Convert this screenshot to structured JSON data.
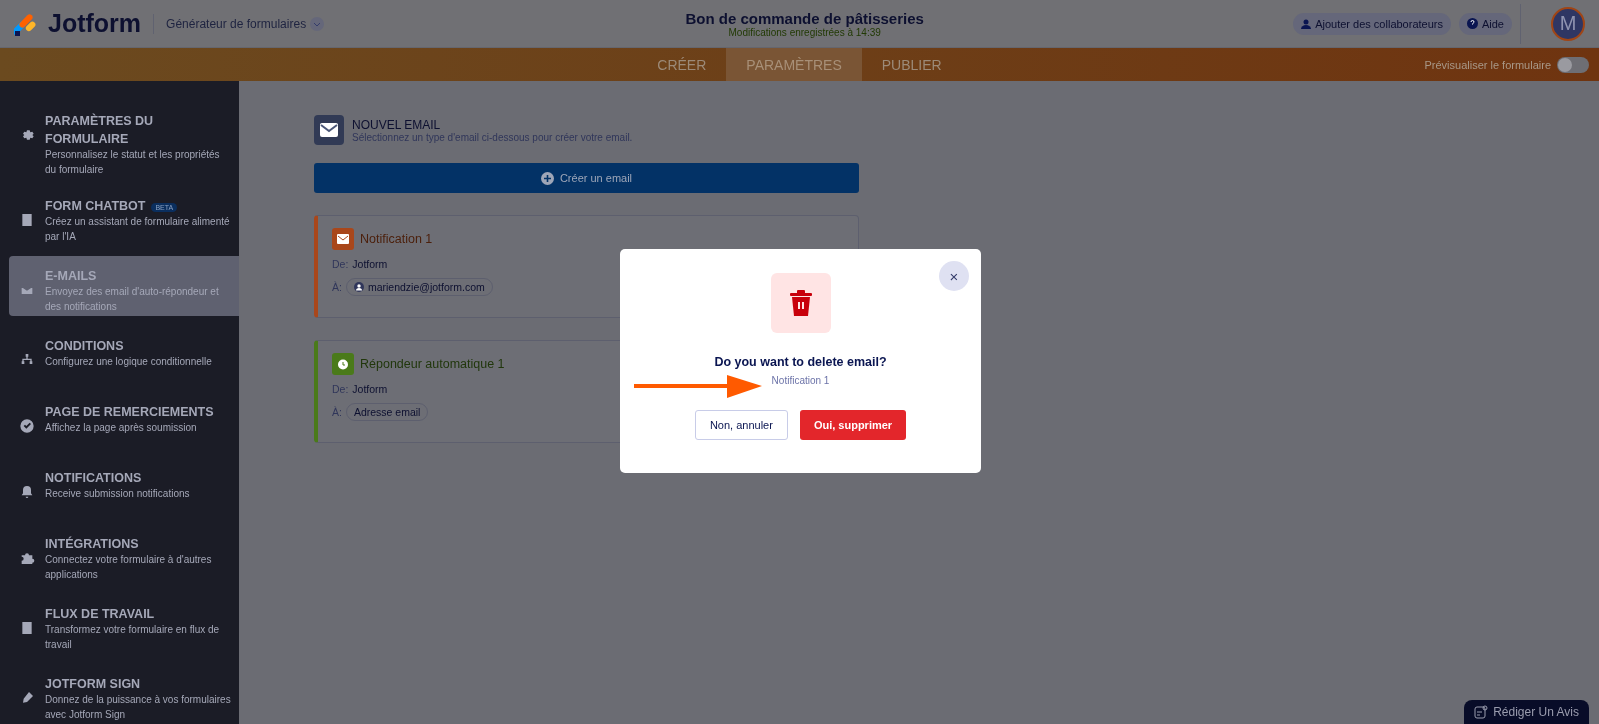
{
  "header": {
    "logo": "Jotform",
    "builder": "Générateur de formulaires",
    "title": "Bon de commande de pâtisseries",
    "saved": "Modifications enregistrées à 14:39",
    "collab": "Ajouter des collaborateurs",
    "help": "Aide",
    "avatar": "M"
  },
  "tabs": [
    {
      "label": "CRÉER",
      "selected": false
    },
    {
      "label": "PARAMÈTRES",
      "selected": true
    },
    {
      "label": "PUBLIER",
      "selected": false
    }
  ],
  "preview": {
    "label": "Prévisualiser le formulaire",
    "on": false
  },
  "sidebar": {
    "items": [
      {
        "title": "PARAMÈTRES DU FORMULAIRE",
        "desc": "Personnalisez le statut et les propriétés du formulaire",
        "selected": false
      },
      {
        "title": "FORM CHATBOT",
        "badge": "BETA",
        "desc": "Créez un assistant de formulaire alimenté par l'IA",
        "selected": false
      },
      {
        "title": "E-MAILS",
        "desc": "Envoyez des email d'auto-répondeur et des notifications",
        "selected": true
      },
      {
        "title": "CONDITIONS",
        "desc": "Configurez une logique conditionnelle",
        "selected": false
      },
      {
        "title": "PAGE DE REMERCIEMENTS",
        "desc": "Affichez la page après soumission",
        "selected": false
      },
      {
        "title": "NOTIFICATIONS",
        "desc": "Receive submission notifications",
        "selected": false
      },
      {
        "title": "INTÉGRATIONS",
        "desc": "Connectez votre formulaire à d'autres applications",
        "selected": false
      },
      {
        "title": "FLUX DE TRAVAIL",
        "desc": "Transformez votre formulaire en flux de travail",
        "selected": false
      },
      {
        "title": "JOTFORM SIGN",
        "desc": "Donnez de la puissance à vos formulaires avec Jotform Sign",
        "selected": false
      }
    ]
  },
  "new_email": {
    "title": "NOUVEL EMAIL",
    "desc": "Sélectionnez un type d'email ci-dessous pour créer votre email.",
    "button": "Créer un email"
  },
  "emails": [
    {
      "kind": "notification",
      "title": "Notification 1",
      "color": "#a9471b",
      "from_label": "De:",
      "from": "Jotform",
      "to_label": "À:",
      "to": "mariendzie@jotform.com",
      "avatar": true
    },
    {
      "kind": "autoresponder",
      "title": "Répondeur automatique 1",
      "color": "#4a7a1a",
      "from_label": "De:",
      "from": "Jotform",
      "to_label": "À:",
      "to": "Adresse email",
      "avatar": false
    }
  ],
  "dialog": {
    "question": "Do you want to delete email?",
    "name": "Notification 1",
    "cancel": "Non, annuler",
    "confirm": "Oui, supprimer",
    "close": "×"
  },
  "review_button": "Rédiger Un Avis"
}
